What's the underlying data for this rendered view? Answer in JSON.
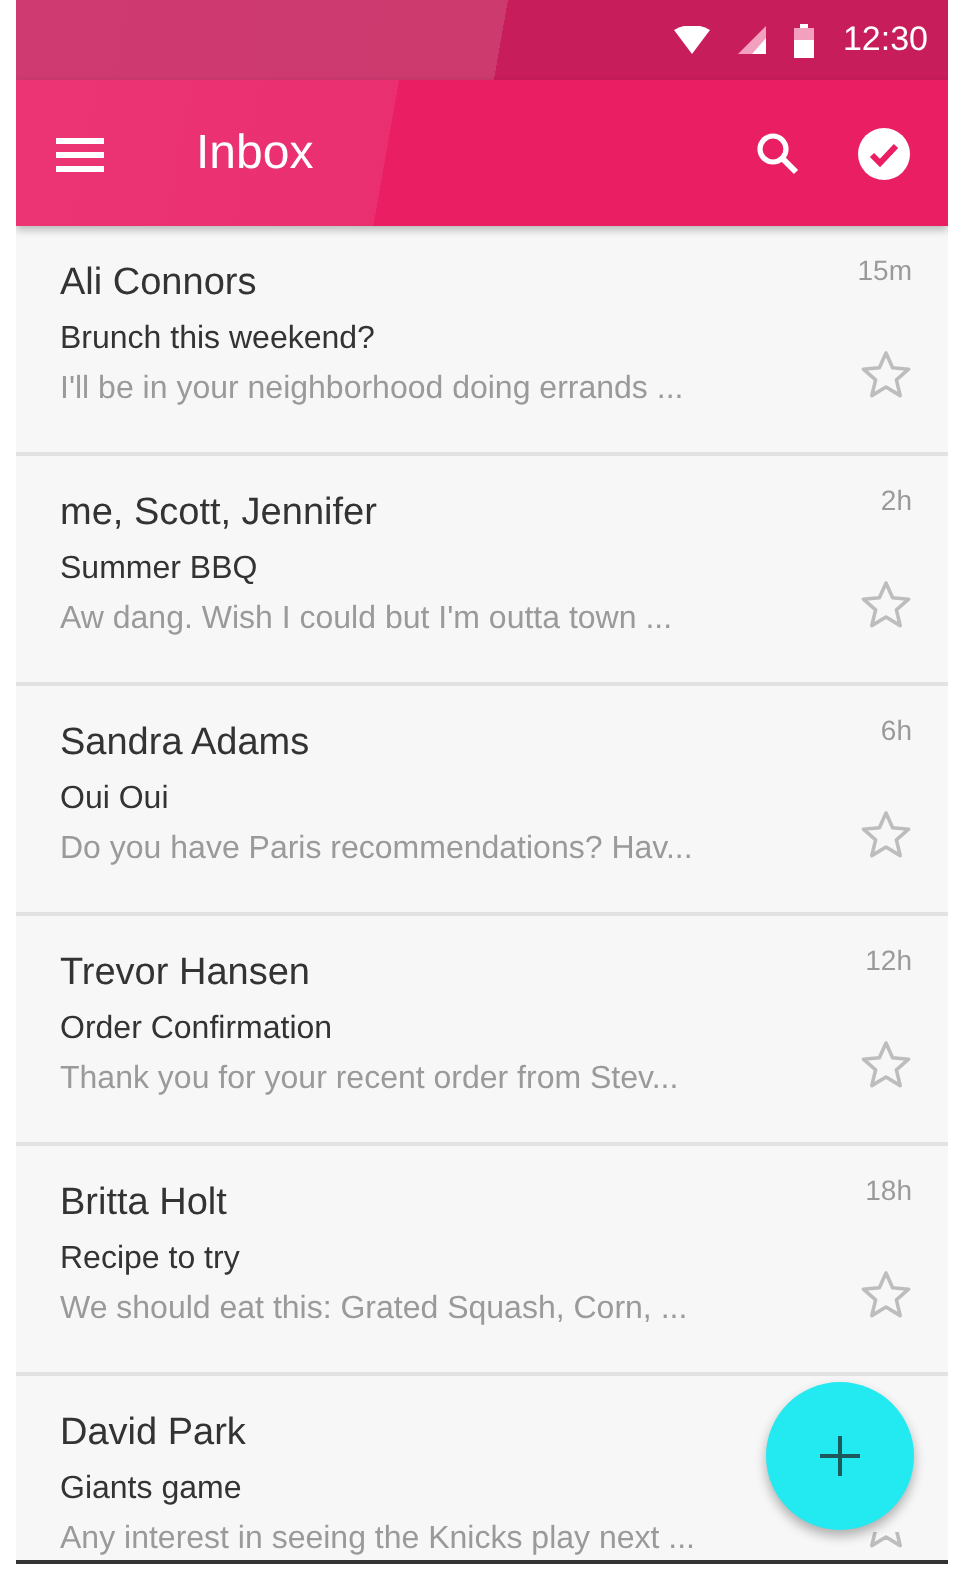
{
  "status_bar": {
    "time": "12:30"
  },
  "app_bar": {
    "title": "Inbox"
  },
  "messages": [
    {
      "sender": "Ali Connors",
      "subject": "Brunch this weekend?",
      "preview": "I'll be in your neighborhood doing errands ...",
      "time": "15m",
      "starred": false
    },
    {
      "sender": "me, Scott, Jennifer",
      "subject": "Summer BBQ",
      "preview": "Aw dang. Wish I could but I'm outta town ...",
      "time": "2h",
      "starred": false
    },
    {
      "sender": "Sandra Adams",
      "subject": "Oui Oui",
      "preview": "Do you have Paris recommendations? Hav...",
      "time": "6h",
      "starred": false
    },
    {
      "sender": "Trevor Hansen",
      "subject": "Order Confirmation",
      "preview": "Thank you for your recent order from Stev...",
      "time": "12h",
      "starred": false
    },
    {
      "sender": "Britta Holt",
      "subject": "Recipe to try",
      "preview": "We should eat this: Grated Squash, Corn, ...",
      "time": "18h",
      "starred": false
    },
    {
      "sender": "David Park",
      "subject": "Giants game",
      "preview": "Any interest in seeing the Knicks play next ...",
      "starred": false
    }
  ]
}
